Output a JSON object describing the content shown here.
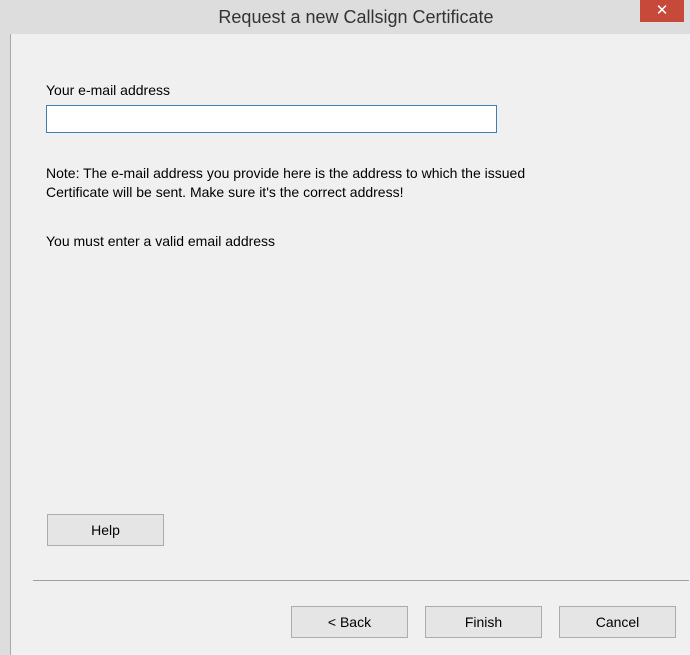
{
  "window": {
    "title": "Request a new Callsign Certificate",
    "close_glyph": "✕"
  },
  "form": {
    "email_label": "Your e-mail address",
    "email_value": "",
    "email_placeholder": "",
    "note_line1": "Note: The e-mail address you provide here is the address to which the issued",
    "note_line2": "Certificate will be sent. Make sure it's the correct address!",
    "validation_message": "You must enter a valid email address"
  },
  "buttons": {
    "help": "Help",
    "back": "< Back",
    "finish": "Finish",
    "cancel": "Cancel"
  },
  "colors": {
    "close_button": "#c7493a",
    "input_focus_border": "#3c7fb1",
    "dialog_background": "#f0f0f0"
  },
  "icons": {
    "close": "close-icon"
  }
}
